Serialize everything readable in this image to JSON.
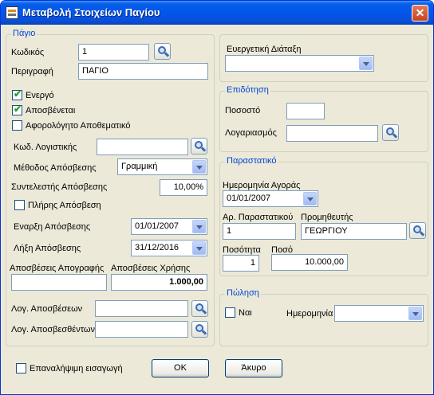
{
  "window": {
    "title": "Μεταβολή Στοιχείων Παγίου"
  },
  "asset": {
    "legend": "Πάγιο",
    "code_label": "Κωδικός",
    "code_value": "1",
    "description_label": "Περιγραφή",
    "description_value": "ΠΑΓΙΟ",
    "active_label": "Ενεργό",
    "active_checked": true,
    "depreciable_label": "Αποσβένεται",
    "depreciable_checked": true,
    "taxfree_label": "Αφορολόγητο Αποθεματικό",
    "taxfree_checked": false,
    "account_code_label": "Κωδ. Λογιστικής",
    "account_code_value": "",
    "method_label": "Μέθοδος Απόσβεσης",
    "method_value": "Γραμμική",
    "rate_label": "Συντελεστής Απόσβεσης",
    "rate_value": "10,00%",
    "full_label": "Πλήρης Απόσβεση",
    "full_checked": false,
    "start_label": "Εναρξη Απόσβεσης",
    "start_value": "01/01/2007",
    "end_label": "Λήξη Απόσβεσης",
    "end_value": "31/12/2016",
    "inv_dep_label": "Αποσβέσεις Απογραφής",
    "inv_dep_value": "",
    "use_dep_label": "Αποσβέσεις Χρήσης",
    "use_dep_value": "1.000,00",
    "acc_dep_label": "Λογ. Αποσβέσεων",
    "acc_dep_value": "",
    "acc_deprd_label": "Λογ. Αποσβεσθέντων",
    "acc_deprd_value": ""
  },
  "directive": {
    "legend": "Ευεργετική Διάταξη",
    "value": ""
  },
  "subsidy": {
    "legend": "Επιδότηση",
    "percent_label": "Ποσοστό",
    "percent_value": "",
    "account_label": "Λογαριασμός",
    "account_value": ""
  },
  "document": {
    "legend": "Παραστατικό",
    "date_label": "Ημερομηνία Αγοράς",
    "date_value": "01/01/2007",
    "number_label": "Αρ. Παραστατικού",
    "number_value": "1",
    "supplier_label": "Προμηθευτής",
    "supplier_value": "ΓΕΩΡΓΙΟΥ",
    "qty_label": "Ποσότητα",
    "qty_value": "1",
    "amount_label": "Ποσό",
    "amount_value": "10.000,00"
  },
  "sale": {
    "legend": "Πώληση",
    "yes_label": "Ναι",
    "yes_checked": false,
    "date_label": "Ημερομηνία",
    "date_value": ""
  },
  "footer": {
    "repeat_label": "Επαναλήψιμη εισαγωγή",
    "repeat_checked": false,
    "ok_label": "OK",
    "cancel_label": "Άκυρο"
  },
  "icons": {
    "lookup": "magnifier-icon",
    "dropdown": "chevron-down-icon",
    "app": "asset-form-icon",
    "close": "close-icon"
  }
}
